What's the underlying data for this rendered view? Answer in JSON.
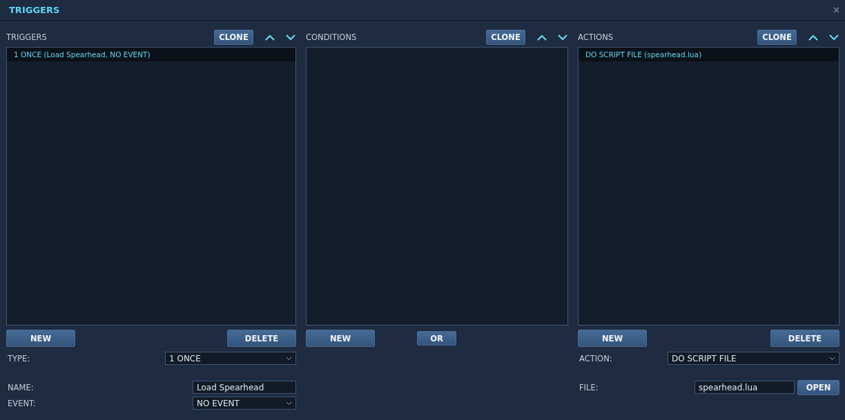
{
  "window": {
    "title": "TRIGGERS"
  },
  "columns": [
    {
      "title": "TRIGGERS",
      "clone": "CLONE",
      "items": [
        {
          "label": "1 ONCE (Load Spearhead, NO EVENT)",
          "selected": true
        }
      ],
      "buttons": [
        {
          "label": "NEW",
          "kind": "wide"
        },
        {
          "label": "DELETE",
          "kind": "wide"
        }
      ],
      "field_groups": [
        [
          {
            "label": "TYPE:",
            "kind": "select",
            "value": "1 ONCE"
          }
        ],
        [
          {
            "label": "NAME:",
            "kind": "text",
            "value": "Load Spearhead"
          },
          {
            "label": "EVENT:",
            "kind": "select",
            "value": "NO EVENT"
          }
        ]
      ]
    },
    {
      "title": "CONDITIONS",
      "clone": "CLONE",
      "buttons": [
        {
          "label": "NEW",
          "kind": "wide"
        },
        {
          "label": "OR",
          "kind": "small"
        }
      ]
    },
    {
      "title": "ACTIONS",
      "clone": "CLONE",
      "items": [
        {
          "label": "DO SCRIPT FILE (spearhead.lua)",
          "selected": true
        }
      ],
      "buttons": [
        {
          "label": "NEW",
          "kind": "wide"
        },
        {
          "label": "DELETE",
          "kind": "wide"
        }
      ],
      "field_groups": [
        [
          {
            "label": "ACTION:",
            "kind": "select",
            "value": "DO SCRIPT FILE"
          }
        ],
        [
          {
            "label": "FILE:",
            "kind": "file",
            "value": "spearhead.lua",
            "button": "OPEN"
          }
        ]
      ]
    }
  ]
}
